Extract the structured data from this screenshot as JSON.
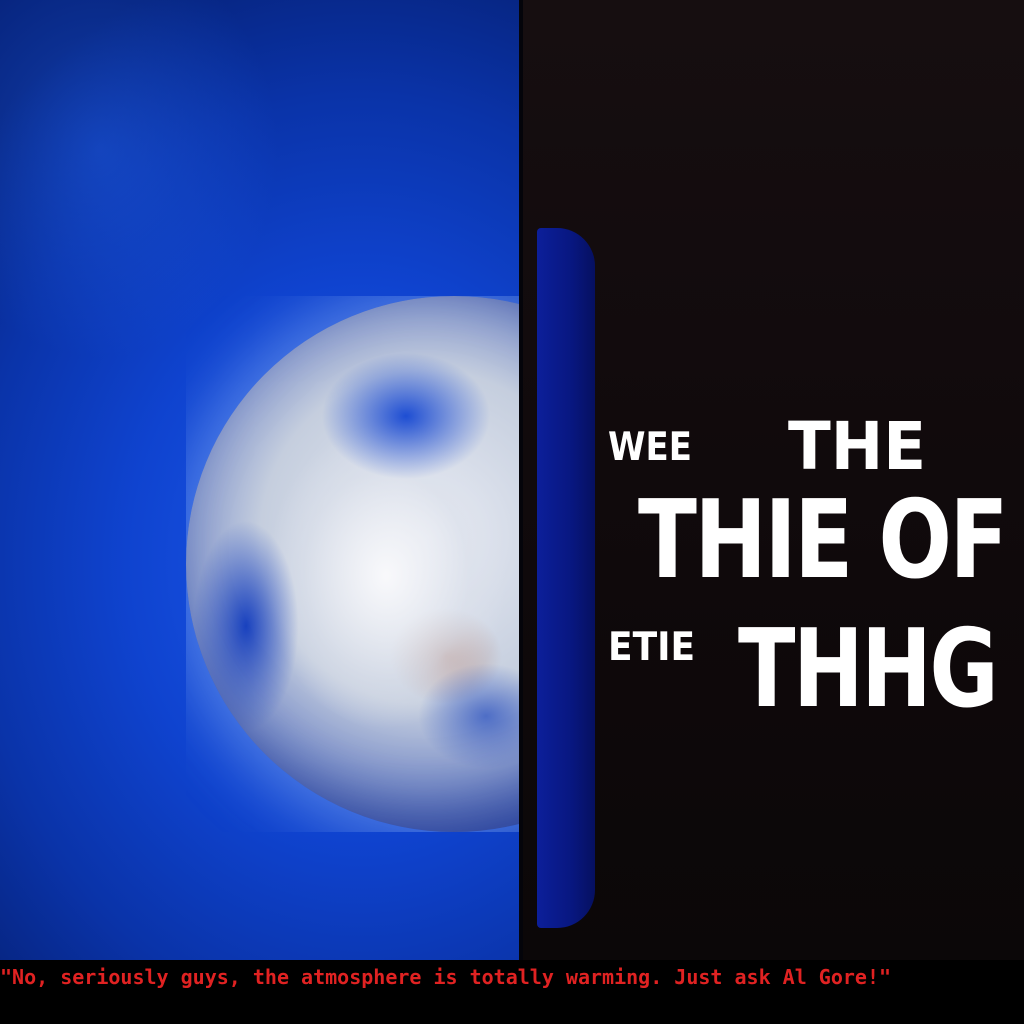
{
  "poster": {
    "line1_small": "WEE",
    "line1_large": "THE",
    "line2": "THIE OF",
    "line3_small": "ETIE",
    "line3_large": "THHG"
  },
  "caption": {
    "text": "\"No, seriously guys, the atmosphere is totally warming. Just ask Al Gore!\"",
    "color": "#e02222"
  },
  "colors": {
    "left_background": "#0f43cf",
    "right_background": "#120b0d",
    "tab": "#0a1a8c",
    "title_text": "#ffffff"
  }
}
